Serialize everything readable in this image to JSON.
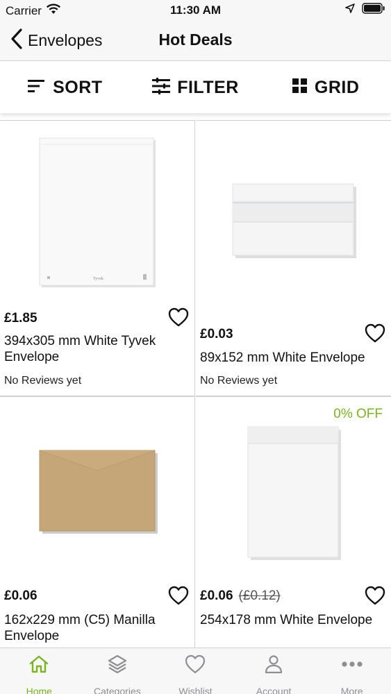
{
  "status_bar": {
    "carrier": "Carrier",
    "time": "11:30 AM"
  },
  "nav": {
    "back_label": "Envelopes",
    "title": "Hot Deals"
  },
  "toolbar": {
    "sort_label": "SORT",
    "filter_label": "FILTER",
    "grid_label": "GRID"
  },
  "products": [
    {
      "price": "£1.85",
      "old_price": "",
      "name": "394x305 mm White Tyvek Envelope",
      "reviews": "No Reviews yet",
      "discount": "",
      "image": "tyvek-envelope-image"
    },
    {
      "price": "£0.03",
      "old_price": "",
      "name": "89x152 mm White Envelope",
      "reviews": "No Reviews yet",
      "discount": "",
      "image": "white-envelope-image"
    },
    {
      "price": "£0.06",
      "old_price": "",
      "name": "162x229 mm (C5) Manilla Envelope",
      "reviews": "",
      "discount": "",
      "image": "manilla-envelope-image"
    },
    {
      "price": "£0.06",
      "old_price": "(£0.12)",
      "name": "254x178 mm White Envelope",
      "reviews": "",
      "discount": "0% OFF",
      "image": "white-pocket-envelope-image"
    }
  ],
  "tabs": [
    {
      "label": "Home",
      "icon": "home-icon",
      "active": true
    },
    {
      "label": "Categories",
      "icon": "layers-icon",
      "active": false
    },
    {
      "label": "Wishlist",
      "icon": "heart-icon",
      "active": false
    },
    {
      "label": "Account",
      "icon": "user-icon",
      "active": false
    },
    {
      "label": "More",
      "icon": "more-icon",
      "active": false
    }
  ],
  "colors": {
    "accent": "#7ab51d",
    "inactive_tab": "#8e8e93",
    "bar_background": "#f7f7f7"
  }
}
